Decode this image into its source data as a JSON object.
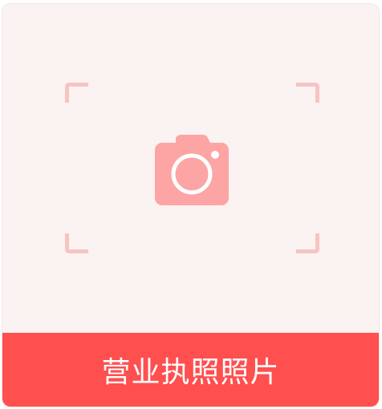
{
  "upload_card": {
    "icon": "camera-icon",
    "label": "营业执照照片",
    "colors": {
      "card_background": "#fbf2f2",
      "corner_bracket": "#f8c3c3",
      "camera": "#fda4a4",
      "label_bar": "#ff4f4f",
      "label_text": "#ffffff"
    }
  }
}
